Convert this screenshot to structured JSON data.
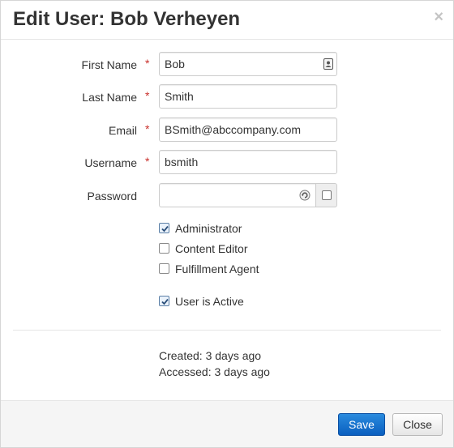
{
  "dialog": {
    "title": "Edit User: Bob Verheyen",
    "close_glyph": "×"
  },
  "form": {
    "required_marker": "*",
    "first_name": {
      "label": "First Name",
      "value": "Bob",
      "icon": "contact-card-icon"
    },
    "last_name": {
      "label": "Last Name",
      "value": "Smith"
    },
    "email": {
      "label": "Email",
      "value": "BSmith@abccompany.com"
    },
    "username": {
      "label": "Username",
      "value": "bsmith"
    },
    "password": {
      "label": "Password",
      "value": "",
      "icon": "password-reveal-icon",
      "show_checkbox_checked": false
    }
  },
  "roles": [
    {
      "label": "Administrator",
      "checked": true
    },
    {
      "label": "Content Editor",
      "checked": false
    },
    {
      "label": "Fulfillment Agent",
      "checked": false
    }
  ],
  "active": {
    "label": "User is Active",
    "checked": true
  },
  "meta": {
    "created": "Created: 3 days ago",
    "accessed": "Accessed: 3 days ago"
  },
  "footer": {
    "save_label": "Save",
    "close_label": "Close"
  },
  "colors": {
    "primary": "#0a6fd1",
    "required": "#c9302c"
  }
}
